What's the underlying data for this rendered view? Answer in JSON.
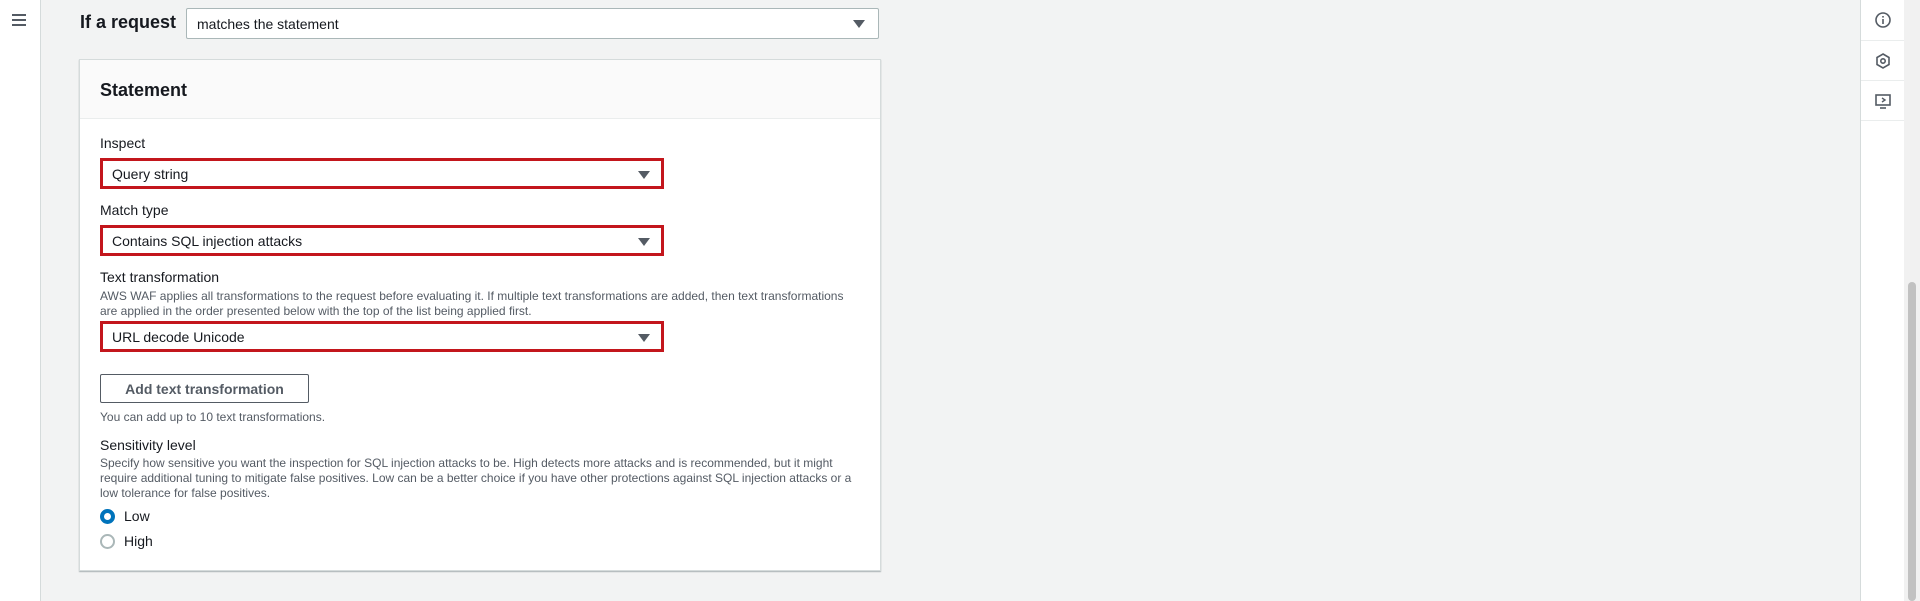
{
  "rule": {
    "if_request_label": "If a request",
    "if_request_value": "matches the statement"
  },
  "statement": {
    "title": "Statement",
    "inspect": {
      "label": "Inspect",
      "value": "Query string"
    },
    "match_type": {
      "label": "Match type",
      "value": "Contains SQL injection attacks"
    },
    "text_transformation": {
      "label": "Text transformation",
      "description": "AWS WAF applies all transformations to the request before evaluating it. If multiple text transformations are added, then text transformations are applied in the order presented below with the top of the list being applied first.",
      "value": "URL decode Unicode",
      "add_button_label": "Add text transformation",
      "hint": "You can add up to 10 text transformations."
    },
    "sensitivity": {
      "label": "Sensitivity level",
      "description": "Specify how sensitive you want the inspection for SQL injection attacks to be. High detects more attacks and is recommended, but it might require additional tuning to mitigate false positives. Low can be a better choice if you have other protections against SQL injection attacks or a low tolerance for false positives.",
      "options": [
        {
          "label": "Low",
          "selected": true
        },
        {
          "label": "High",
          "selected": false
        }
      ]
    }
  },
  "icons": {
    "left": "hamburger-menu-icon",
    "right": [
      "info-icon",
      "gear-hexagon-icon",
      "feedback-screen-icon"
    ]
  },
  "colors": {
    "highlight_border": "#c3161c",
    "radio_selected": "#0073bb",
    "background": "#f2f3f3"
  }
}
